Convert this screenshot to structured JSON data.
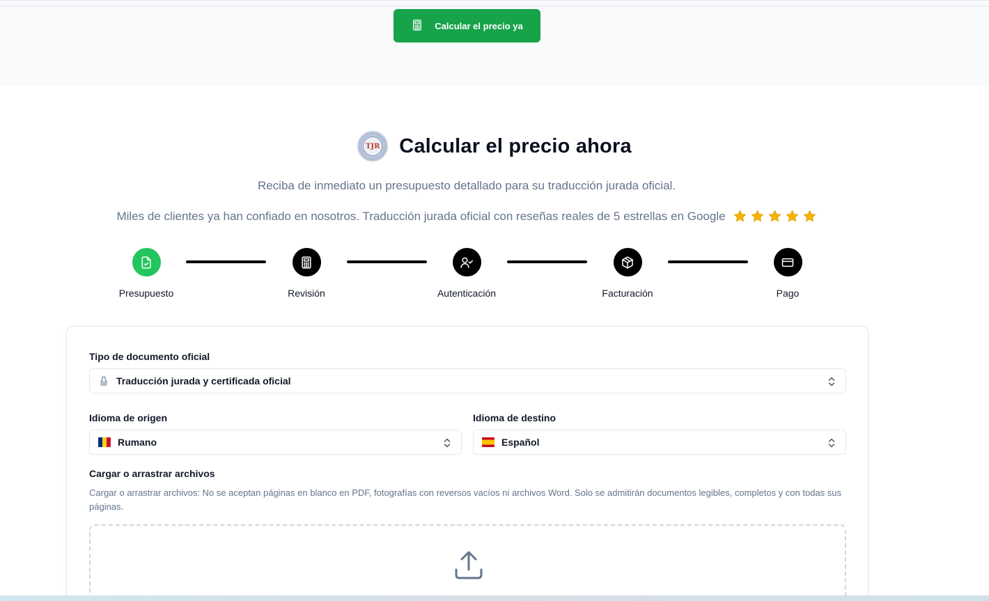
{
  "header": {
    "cta_label": "Calcular el precio ya",
    "cta_icon": "calculator-icon"
  },
  "hero": {
    "title": "Calcular el precio ahora",
    "logo_text": "TJR",
    "subtitle": "Reciba de inmediato un presupuesto detallado para su traducción jurada oficial.",
    "reviews_text": "Miles de clientes ya han confiado en nosotros. Traducción jurada oficial con reseñas reales de 5 estrellas en Google",
    "stars": 5
  },
  "steps": [
    {
      "label": "Presupuesto",
      "icon": "file-check-icon",
      "active": true
    },
    {
      "label": "Revisión",
      "icon": "calculator-icon",
      "active": false
    },
    {
      "label": "Autenticación",
      "icon": "user-check-icon",
      "active": false
    },
    {
      "label": "Facturación",
      "icon": "package-icon",
      "active": false
    },
    {
      "label": "Pago",
      "icon": "credit-card-icon",
      "active": false
    }
  ],
  "form": {
    "doc_type_label": "Tipo de documento oficial",
    "doc_type_value": "Traducción jurada y certificada oficial",
    "source_lang_label": "Idioma de origen",
    "source_lang_value": "Rumano",
    "target_lang_label": "Idioma de destino",
    "target_lang_value": "Español",
    "upload_label": "Cargar o arrastrar archivos",
    "upload_help": "Cargar o arrastrar archivos: No se aceptan páginas en blanco en PDF, fotografías con reversos vacíos ni archivos Word. Solo se admitirán documentos legibles, completos y con todas sus páginas."
  },
  "colors": {
    "accent_green": "#16a34a",
    "step_active": "#22c55e",
    "step_inactive": "#000000",
    "muted_text": "#64748b",
    "star": "#f5b400"
  }
}
